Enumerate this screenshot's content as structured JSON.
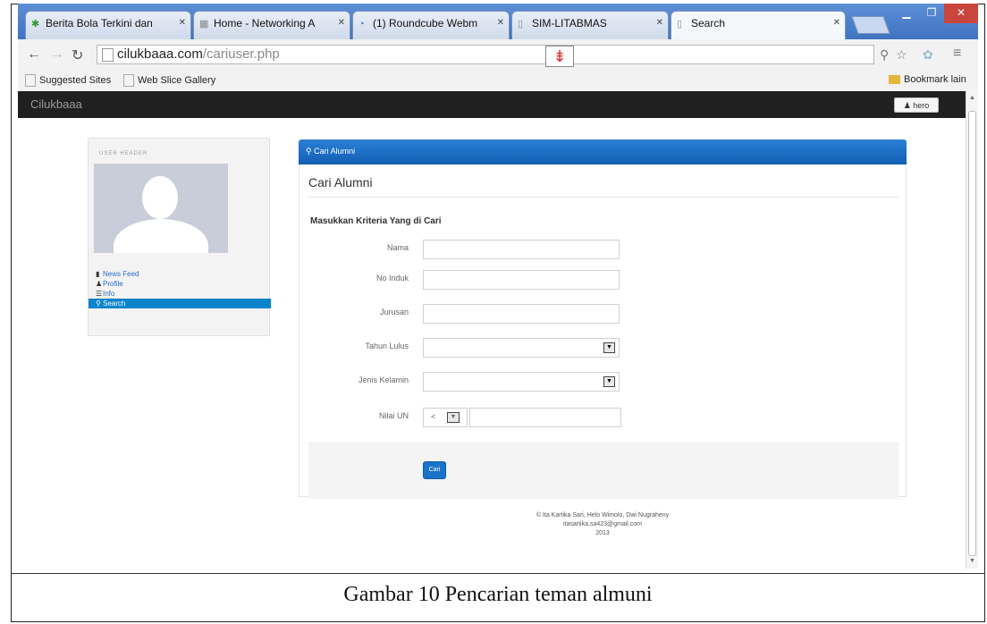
{
  "browser": {
    "tabs": [
      {
        "label": "Berita Bola Terkini dan",
        "icon": "green-figure-icon"
      },
      {
        "label": "Home - Networking A",
        "icon": "grid-icon"
      },
      {
        "label": "(1) Roundcube Webm",
        "icon": "blue-globe-icon"
      },
      {
        "label": "SIM-LITABMAS",
        "icon": "page-icon"
      },
      {
        "label": "Search",
        "icon": "page-icon"
      }
    ],
    "address": {
      "domain": "cilukbaaa.com",
      "path": "/cariuser.php"
    },
    "bookmarks": [
      {
        "label": "Suggested Sites"
      },
      {
        "label": "Web Slice Gallery"
      },
      {
        "label": "Bookmark lain"
      }
    ]
  },
  "app": {
    "brand": "Cilukbaaa",
    "user_button": "hero"
  },
  "sidebar": {
    "header": "USER HEADER",
    "menu": [
      {
        "label": "News Feed",
        "icon": "file-icon"
      },
      {
        "label": "Profile",
        "icon": "user-icon"
      },
      {
        "label": "Info",
        "icon": "list-icon"
      },
      {
        "label": "Search",
        "icon": "search-icon",
        "active": true
      }
    ]
  },
  "panel": {
    "header": "Cari Alumni",
    "title": "Cari Alumni",
    "subtitle": "Masukkan Kriteria Yang di Cari",
    "fields": [
      {
        "label": "Nama",
        "type": "text",
        "value": ""
      },
      {
        "label": "No Induk",
        "type": "text",
        "value": ""
      },
      {
        "label": "Jurusan",
        "type": "text",
        "value": ""
      },
      {
        "label": "Tahun Lulus",
        "type": "select",
        "value": ""
      },
      {
        "label": "Jenis Kelamin",
        "type": "select",
        "value": ""
      },
      {
        "label": "Nilai UN",
        "type": "compare",
        "operator": "<",
        "value": ""
      }
    ],
    "submit": "Cari"
  },
  "footer": {
    "line1": "© Ita Kartika Sari, Helo Wimolo, Dwi Nugraheny",
    "line2": "itasartika.sa423@gmail.com",
    "line3": "2013"
  },
  "caption": "Gambar 10 Pencarian teman almuni"
}
